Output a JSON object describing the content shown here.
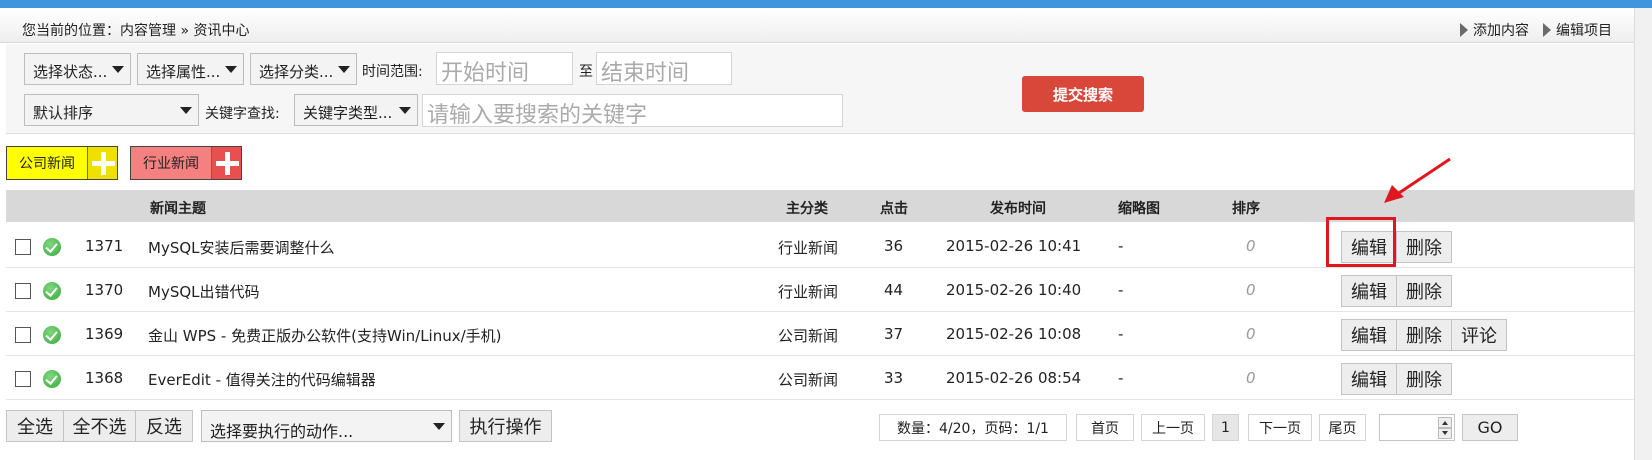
{
  "breadcrumb": "您当前的位置：内容管理 » 资讯中心",
  "header_links": [
    {
      "label": "添加内容"
    },
    {
      "label": "编辑项目"
    }
  ],
  "search": {
    "status_select": "选择状态...",
    "attr_select": "选择属性...",
    "category_select": "选择分类...",
    "time_range_label": "时间范围:",
    "start_placeholder": "开始时间",
    "to_label": "至",
    "end_placeholder": "结束时间",
    "sort_select": "默认排序",
    "keyword_label": "关键字查找:",
    "keyword_type_select": "关键字类型...",
    "keyword_placeholder": "请输入要搜索的关键字",
    "submit_label": "提交搜索"
  },
  "categories": [
    {
      "label": "公司新闻",
      "color": "#ffff00",
      "plus_color": "#f0e000"
    },
    {
      "label": "行业新闻",
      "color": "#f58080",
      "plus_color": "#e85050"
    }
  ],
  "table": {
    "headers": {
      "title": "新闻主题",
      "category": "主分类",
      "clicks": "点击",
      "date": "发布时间",
      "thumb": "缩略图",
      "order": "排序"
    },
    "rows": [
      {
        "id": "1371",
        "title": "MySQL安装后需要调整什么",
        "category": "行业新闻",
        "clicks": "36",
        "date": "2015-02-26 10:41",
        "thumb": "-",
        "order": "0",
        "actions": [
          "编辑",
          "删除"
        ]
      },
      {
        "id": "1370",
        "title": "MySQL出错代码",
        "category": "行业新闻",
        "clicks": "44",
        "date": "2015-02-26 10:40",
        "thumb": "-",
        "order": "0",
        "actions": [
          "编辑",
          "删除"
        ]
      },
      {
        "id": "1369",
        "title": "金山 WPS - 免费正版办公软件(支持Win/Linux/手机)",
        "category": "公司新闻",
        "clicks": "37",
        "date": "2015-02-26 10:08",
        "thumb": "-",
        "order": "0",
        "actions": [
          "编辑",
          "删除",
          "评论"
        ]
      },
      {
        "id": "1368",
        "title": "EverEdit - 值得关注的代码编辑器",
        "category": "公司新闻",
        "clicks": "33",
        "date": "2015-02-26 08:54",
        "thumb": "-",
        "order": "0",
        "actions": [
          "编辑",
          "删除"
        ]
      }
    ]
  },
  "footer": {
    "select_all": "全选",
    "select_none": "全不选",
    "invert": "反选",
    "action_select": "选择要执行的动作...",
    "execute": "执行操作",
    "count_info": "数量：4/20，页码：1/1",
    "first": "首页",
    "prev": "上一页",
    "current_page": "1",
    "next": "下一页",
    "last": "尾页",
    "go": "GO"
  },
  "accent_colors": {
    "submit": "#d9463a",
    "highlight": "#e0171f",
    "topbar": "#3f96dc"
  }
}
